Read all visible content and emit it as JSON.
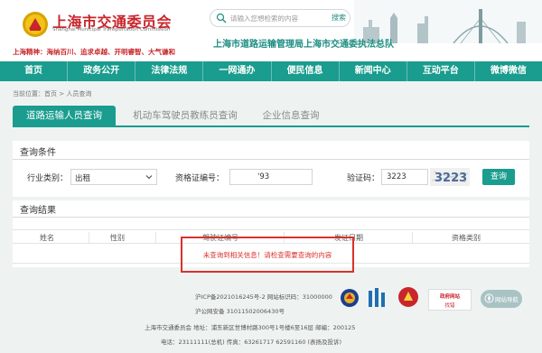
{
  "header": {
    "org_name": "上海市交通委员会",
    "org_name_en": "Shanghai Municipal Transportation Commission",
    "slogan": "上海精神：海纳百川、追求卓越、开明睿智、大气谦和",
    "search_placeholder": "请输入您想检索的内容",
    "search_button": "搜索",
    "subtitle": "上海市道路运输管理局上海市交通委执法总队"
  },
  "nav": {
    "items": [
      "首页",
      "政务公开",
      "法律法规",
      "一网通办",
      "便民信息",
      "新闻中心",
      "互动平台",
      "微博微信"
    ]
  },
  "breadcrumb": "当前位置：首页 > 人员查询",
  "tabs": {
    "active": "道路运输人员查询",
    "second": "机动车驾驶员教练员查询",
    "third": "企业信息查询"
  },
  "query": {
    "section_title": "查询条件",
    "industry_label": "行业类别：",
    "industry_value": "出租",
    "cert_label": "资格证编号：",
    "cert_value": "'93",
    "captcha_label": "验证码：",
    "captcha_value": "3223",
    "captcha_image_text": "3223",
    "search_button": "查询"
  },
  "results": {
    "section_title": "查询结果",
    "columns": [
      "姓名",
      "性别",
      "驾驶证编号",
      "发证日期",
      "资格类别"
    ],
    "message": "未查询到相关信息！请检查需要查询的内容"
  },
  "footer": {
    "icp": "沪ICP备2021016245号-2 网站标识码：31000000",
    "police": "沪公网安备 31011502006430号",
    "address": "上海市交通委员会 地址：浦东新区世博村路300号1号楼6至16层 邮编：200125",
    "phone": "电话：23111111(总机) 传真：63261717 62591160 (表扬及投诉)",
    "badge_text_1": "政府网站",
    "badge_text_2": "找错",
    "guide_label": "网站导航"
  }
}
